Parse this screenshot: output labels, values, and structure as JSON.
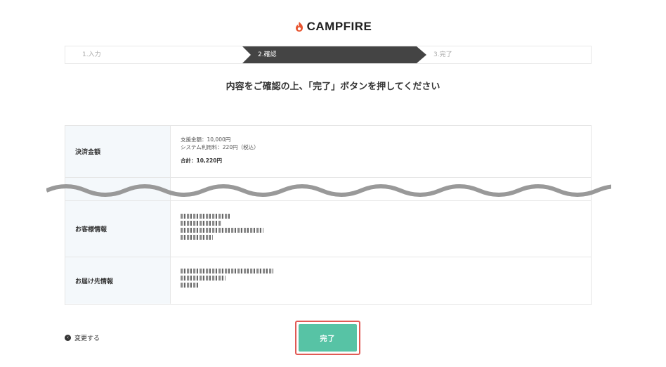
{
  "brand": {
    "name": "CAMPFIRE",
    "logo_icon": "flame-icon",
    "accent": "#e8542f"
  },
  "steps": [
    {
      "label": "1.入力",
      "active": false
    },
    {
      "label": "2.確認",
      "active": true
    },
    {
      "label": "3.完了",
      "active": false
    }
  ],
  "headline": "内容をご確認の上、「完了」ボタンを押してください",
  "payment": {
    "label": "決済金額",
    "support_amount": "支援金額：10,000円",
    "system_fee": "システム利用料：220円（税込）",
    "total": "合計：10,220円"
  },
  "customer": {
    "label": "お客様情報"
  },
  "delivery": {
    "label": "お届け先情報"
  },
  "back_link": {
    "label": "変更する",
    "icon": "chevron-left-icon"
  },
  "complete_button": {
    "label": "完了",
    "color": "#57c3a5",
    "highlight": "#e15a55"
  }
}
